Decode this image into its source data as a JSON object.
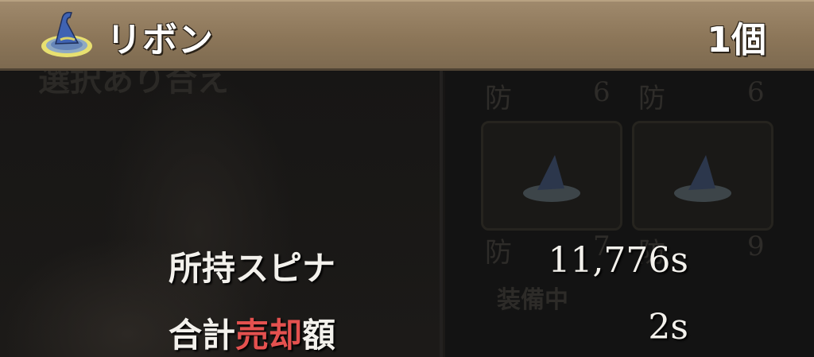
{
  "item": {
    "icon": "wizard-hat-icon",
    "name": "リボン",
    "count": "1個"
  },
  "background": {
    "screen_label": "選択あり合え",
    "stat_label": "防",
    "stats": [
      "6",
      "6",
      "7",
      "9"
    ],
    "equipped_label": "装備中"
  },
  "info": {
    "owned_label": "所持スピナ",
    "owned_value": "11,776s",
    "total_label_prefix": "合計",
    "total_label_highlight": "売却",
    "total_label_suffix": "額",
    "total_value": "2s"
  },
  "colors": {
    "header_bg": "#8c7659",
    "highlight": "#e4514f",
    "text": "#f3f1ec"
  }
}
